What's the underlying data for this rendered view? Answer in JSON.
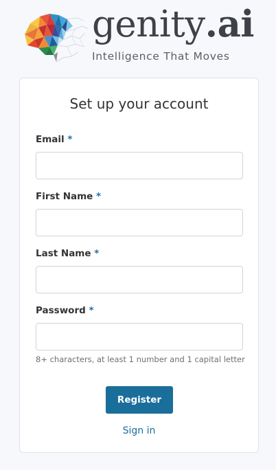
{
  "brand": {
    "name_main": "genity",
    "name_dot_ai": ".ai",
    "tagline": "Intelligence That Moves",
    "logo_icon": "polygon-brain-icon"
  },
  "form": {
    "title": "Set up your account",
    "required_marker": "*",
    "fields": [
      {
        "label": "Email",
        "value": "",
        "placeholder": ""
      },
      {
        "label": "First Name",
        "value": "",
        "placeholder": ""
      },
      {
        "label": "Last Name",
        "value": "",
        "placeholder": ""
      },
      {
        "label": "Password",
        "value": "",
        "placeholder": ""
      }
    ],
    "password_hint": "8+ characters, at least 1 number and 1 capital letter",
    "register_label": "Register",
    "signin_label": "Sign in"
  },
  "colors": {
    "accent": "#1a6e9a",
    "page_background": "#f7f8fb",
    "card_border": "#dfe2e6"
  }
}
